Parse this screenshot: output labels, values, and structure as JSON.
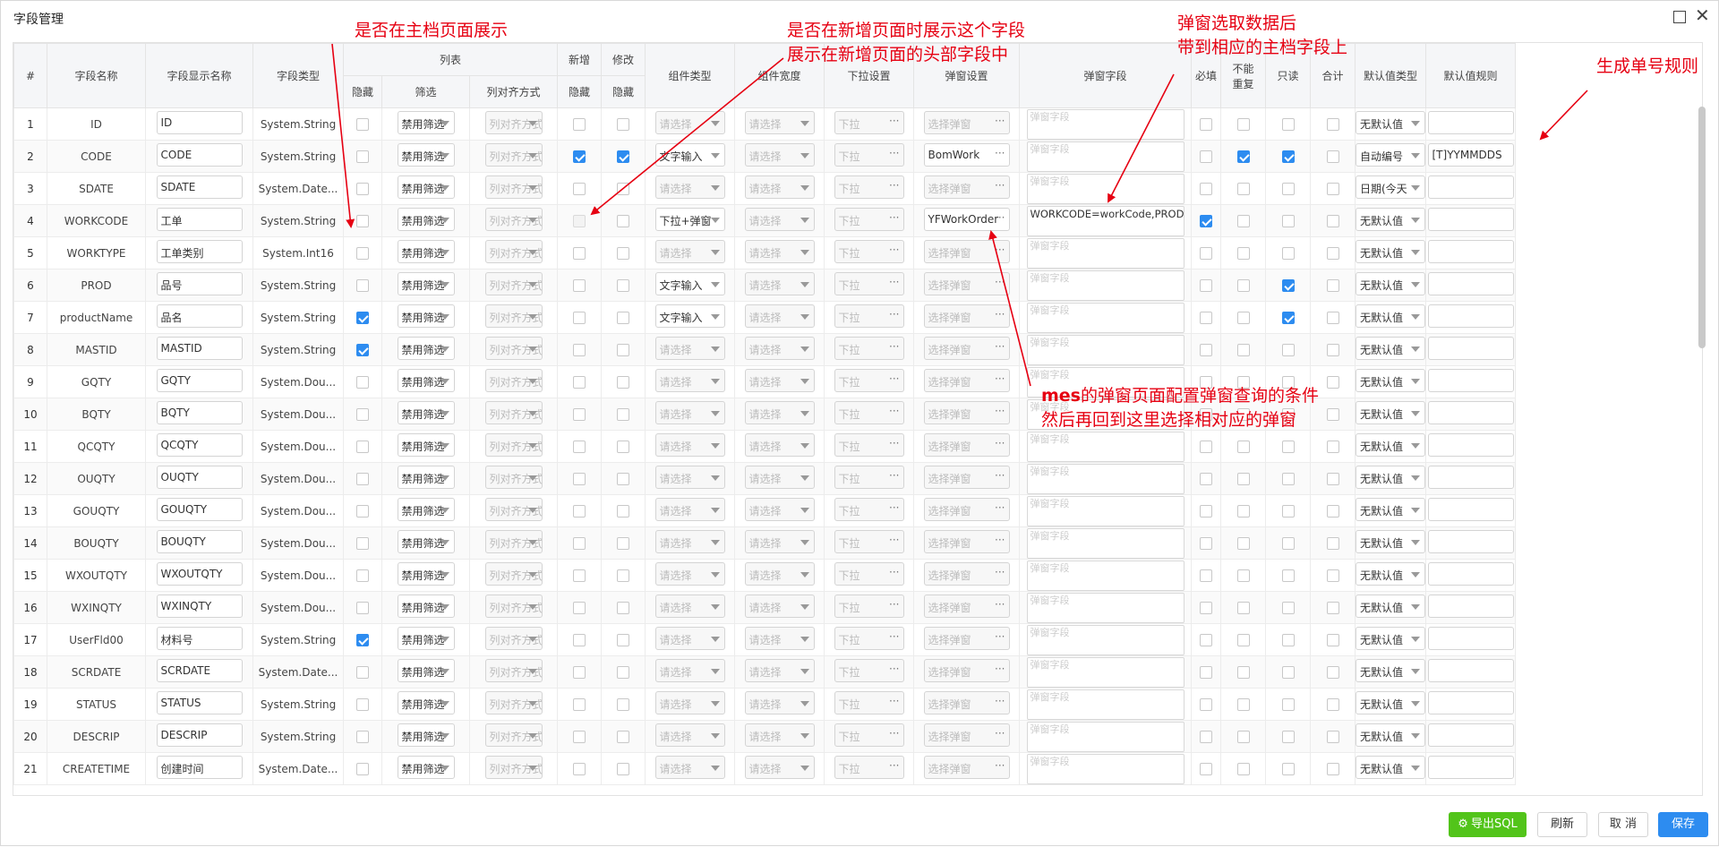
{
  "window": {
    "title": "字段管理",
    "max_icon": "maximize-icon",
    "close_icon": "close-icon"
  },
  "headers": {
    "no": "#",
    "field_name": "字段名称",
    "display_name": "字段显示名称",
    "field_type": "字段类型",
    "list_group": "列表",
    "hidden": "隐藏",
    "filter": "筛选",
    "align": "列对齐方式",
    "add_group": "新增",
    "edit_group": "修改",
    "comp_type": "组件类型",
    "comp_width": "组件宽度",
    "dropdown": "下拉设置",
    "popup": "弹窗设置",
    "popup_field": "弹窗字段",
    "required": "必填",
    "unique1": "不能",
    "unique2": "重复",
    "readonly": "只读",
    "sum": "合计",
    "default_type": "默认值类型",
    "default_rule": "默认值规则"
  },
  "placeholders": {
    "select": "请选择",
    "align": "列对齐方式",
    "dropdown": "下拉",
    "popup": "选择弹窗",
    "popup_field": "弹窗字段"
  },
  "rows": [
    {
      "no": "1",
      "name": "ID",
      "display": "ID",
      "type": "System.String",
      "hidden": false,
      "filter": "禁用筛选",
      "add_hidden": false,
      "edit_hidden": false,
      "comp": "",
      "popup": "",
      "popup_field": "",
      "required": false,
      "unique": false,
      "readonly": false,
      "sum": false,
      "default_type": "无默认值",
      "default_rule": ""
    },
    {
      "no": "2",
      "name": "CODE",
      "display": "CODE",
      "type": "System.String",
      "hidden": false,
      "filter": "禁用筛选",
      "add_hidden": true,
      "edit_hidden": true,
      "comp": "文字输入",
      "popup": "BomWork",
      "popup_field": "",
      "required": false,
      "unique": true,
      "readonly": true,
      "sum": false,
      "default_type": "自动编号",
      "default_rule": "[T]YYMMDDS"
    },
    {
      "no": "3",
      "name": "SDATE",
      "display": "SDATE",
      "type": "System.Date...",
      "hidden": false,
      "filter": "禁用筛选",
      "add_hidden": false,
      "edit_hidden": false,
      "comp": "",
      "popup": "",
      "popup_field": "",
      "required": false,
      "unique": false,
      "readonly": false,
      "sum": false,
      "default_type": "日期(今天",
      "default_rule": ""
    },
    {
      "no": "4",
      "name": "WORKCODE",
      "display": "工单",
      "type": "System.String",
      "hidden": false,
      "filter": "禁用筛选",
      "add_hidden": false,
      "edit_hidden": false,
      "comp": "下拉+弹窗",
      "popup": "YFWorkOrder",
      "popup_field": "WORKCODE=workCode,PROD=productCode,productName=",
      "required": true,
      "unique": false,
      "readonly": false,
      "sum": false,
      "default_type": "无默认值",
      "default_rule": ""
    },
    {
      "no": "5",
      "name": "WORKTYPE",
      "display": "工单类别",
      "type": "System.Int16",
      "hidden": false,
      "filter": "禁用筛选",
      "add_hidden": false,
      "edit_hidden": false,
      "comp": "",
      "popup": "",
      "popup_field": "",
      "required": false,
      "unique": false,
      "readonly": false,
      "sum": false,
      "default_type": "无默认值",
      "default_rule": ""
    },
    {
      "no": "6",
      "name": "PROD",
      "display": "品号",
      "type": "System.String",
      "hidden": false,
      "filter": "禁用筛选",
      "add_hidden": false,
      "edit_hidden": false,
      "comp": "文字输入",
      "popup": "",
      "popup_field": "",
      "required": false,
      "unique": false,
      "readonly": true,
      "sum": false,
      "default_type": "无默认值",
      "default_rule": ""
    },
    {
      "no": "7",
      "name": "productName",
      "display": "品名",
      "type": "System.String",
      "hidden": true,
      "filter": "禁用筛选",
      "add_hidden": false,
      "edit_hidden": false,
      "comp": "文字输入",
      "popup": "",
      "popup_field": "",
      "required": false,
      "unique": false,
      "readonly": true,
      "sum": false,
      "default_type": "无默认值",
      "default_rule": ""
    },
    {
      "no": "8",
      "name": "MASTID",
      "display": "MASTID",
      "type": "System.String",
      "hidden": true,
      "filter": "禁用筛选",
      "add_hidden": false,
      "edit_hidden": false,
      "comp": "",
      "popup": "",
      "popup_field": "",
      "required": false,
      "unique": false,
      "readonly": false,
      "sum": false,
      "default_type": "无默认值",
      "default_rule": ""
    },
    {
      "no": "9",
      "name": "GQTY",
      "display": "GQTY",
      "type": "System.Dou...",
      "hidden": false,
      "filter": "禁用筛选",
      "add_hidden": false,
      "edit_hidden": false,
      "comp": "",
      "popup": "",
      "popup_field": "",
      "required": false,
      "unique": false,
      "readonly": false,
      "sum": false,
      "default_type": "无默认值",
      "default_rule": ""
    },
    {
      "no": "10",
      "name": "BQTY",
      "display": "BQTY",
      "type": "System.Dou...",
      "hidden": false,
      "filter": "禁用筛选",
      "add_hidden": false,
      "edit_hidden": false,
      "comp": "",
      "popup": "",
      "popup_field": "",
      "required": false,
      "unique": false,
      "readonly": false,
      "sum": false,
      "default_type": "无默认值",
      "default_rule": ""
    },
    {
      "no": "11",
      "name": "QCQTY",
      "display": "QCQTY",
      "type": "System.Dou...",
      "hidden": false,
      "filter": "禁用筛选",
      "add_hidden": false,
      "edit_hidden": false,
      "comp": "",
      "popup": "",
      "popup_field": "",
      "required": false,
      "unique": false,
      "readonly": false,
      "sum": false,
      "default_type": "无默认值",
      "default_rule": ""
    },
    {
      "no": "12",
      "name": "OUQTY",
      "display": "OUQTY",
      "type": "System.Dou...",
      "hidden": false,
      "filter": "禁用筛选",
      "add_hidden": false,
      "edit_hidden": false,
      "comp": "",
      "popup": "",
      "popup_field": "",
      "required": false,
      "unique": false,
      "readonly": false,
      "sum": false,
      "default_type": "无默认值",
      "default_rule": ""
    },
    {
      "no": "13",
      "name": "GOUQTY",
      "display": "GOUQTY",
      "type": "System.Dou...",
      "hidden": false,
      "filter": "禁用筛选",
      "add_hidden": false,
      "edit_hidden": false,
      "comp": "",
      "popup": "",
      "popup_field": "",
      "required": false,
      "unique": false,
      "readonly": false,
      "sum": false,
      "default_type": "无默认值",
      "default_rule": ""
    },
    {
      "no": "14",
      "name": "BOUQTY",
      "display": "BOUQTY",
      "type": "System.Dou...",
      "hidden": false,
      "filter": "禁用筛选",
      "add_hidden": false,
      "edit_hidden": false,
      "comp": "",
      "popup": "",
      "popup_field": "",
      "required": false,
      "unique": false,
      "readonly": false,
      "sum": false,
      "default_type": "无默认值",
      "default_rule": ""
    },
    {
      "no": "15",
      "name": "WXOUTQTY",
      "display": "WXOUTQTY",
      "type": "System.Dou...",
      "hidden": false,
      "filter": "禁用筛选",
      "add_hidden": false,
      "edit_hidden": false,
      "comp": "",
      "popup": "",
      "popup_field": "",
      "required": false,
      "unique": false,
      "readonly": false,
      "sum": false,
      "default_type": "无默认值",
      "default_rule": ""
    },
    {
      "no": "16",
      "name": "WXINQTY",
      "display": "WXINQTY",
      "type": "System.Dou...",
      "hidden": false,
      "filter": "禁用筛选",
      "add_hidden": false,
      "edit_hidden": false,
      "comp": "",
      "popup": "",
      "popup_field": "",
      "required": false,
      "unique": false,
      "readonly": false,
      "sum": false,
      "default_type": "无默认值",
      "default_rule": ""
    },
    {
      "no": "17",
      "name": "UserFld00",
      "display": "材料号",
      "type": "System.String",
      "hidden": true,
      "filter": "禁用筛选",
      "add_hidden": false,
      "edit_hidden": false,
      "comp": "",
      "popup": "",
      "popup_field": "",
      "required": false,
      "unique": false,
      "readonly": false,
      "sum": false,
      "default_type": "无默认值",
      "default_rule": ""
    },
    {
      "no": "18",
      "name": "SCRDATE",
      "display": "SCRDATE",
      "type": "System.Date...",
      "hidden": false,
      "filter": "禁用筛选",
      "add_hidden": false,
      "edit_hidden": false,
      "comp": "",
      "popup": "",
      "popup_field": "",
      "required": false,
      "unique": false,
      "readonly": false,
      "sum": false,
      "default_type": "无默认值",
      "default_rule": ""
    },
    {
      "no": "19",
      "name": "STATUS",
      "display": "STATUS",
      "type": "System.String",
      "hidden": false,
      "filter": "禁用筛选",
      "add_hidden": false,
      "edit_hidden": false,
      "comp": "",
      "popup": "",
      "popup_field": "",
      "required": false,
      "unique": false,
      "readonly": false,
      "sum": false,
      "default_type": "无默认值",
      "default_rule": ""
    },
    {
      "no": "20",
      "name": "DESCRIP",
      "display": "DESCRIP",
      "type": "System.String",
      "hidden": false,
      "filter": "禁用筛选",
      "add_hidden": false,
      "edit_hidden": false,
      "comp": "",
      "popup": "",
      "popup_field": "",
      "required": false,
      "unique": false,
      "readonly": false,
      "sum": false,
      "default_type": "无默认值",
      "default_rule": ""
    },
    {
      "no": "21",
      "name": "CREATETIME",
      "display": "创建时间",
      "type": "System.Date...",
      "hidden": false,
      "filter": "禁用筛选",
      "add_hidden": false,
      "edit_hidden": false,
      "comp": "",
      "popup": "",
      "popup_field": "",
      "required": false,
      "unique": false,
      "readonly": false,
      "sum": false,
      "default_type": "无默认值",
      "default_rule": ""
    }
  ],
  "annotations": {
    "a1": "是否在主档页面展示",
    "a2_l1": "是否在新增页面时展示这个字段",
    "a2_l2": "展示在新增页面的头部字段中",
    "a3_l1": "弹窗选取数据后",
    "a3_l2": "带到相应的主档字段上",
    "a4": "生成单号规则",
    "a5_bold": "mes",
    "a5_l1": "的弹窗页面配置弹窗查询的条件",
    "a5_l2": "然后再回到这里选择相对应的弹窗",
    "color": "#e60012"
  },
  "footer": {
    "export": "导出SQL",
    "export_icon": "gear-icon",
    "refresh": "刷新",
    "cancel": "取 消",
    "save": "保存"
  },
  "colors": {
    "primary": "#2d8cf0",
    "success": "#52c41a",
    "header_bg": "#f5f6f8"
  }
}
